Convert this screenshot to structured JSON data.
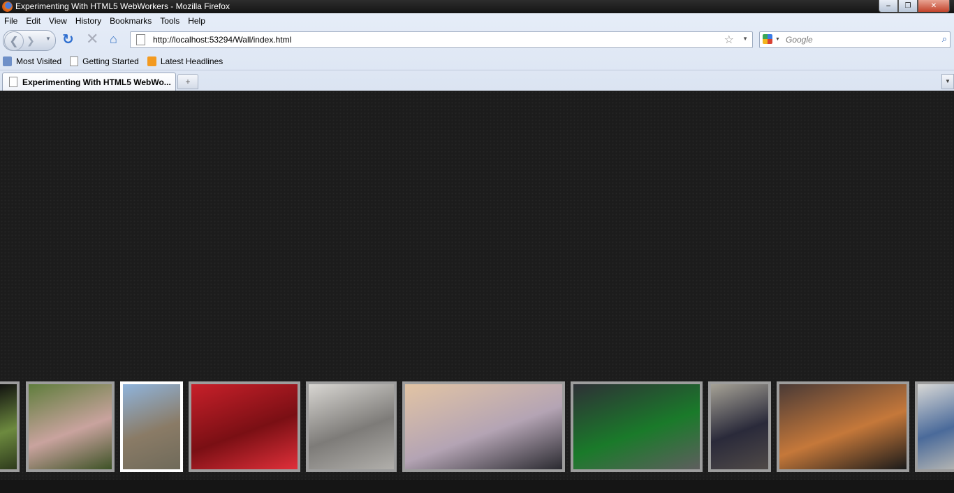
{
  "window": {
    "title": "Experimenting With HTML5 WebWorkers - Mozilla Firefox",
    "controls": {
      "minimize": "‒",
      "restore": "❐",
      "close": "✕"
    }
  },
  "menu": {
    "items": [
      "File",
      "Edit",
      "View",
      "History",
      "Bookmarks",
      "Tools",
      "Help"
    ]
  },
  "navigation": {
    "url": "http://localhost:53294/Wall/index.html",
    "search_placeholder": "Google",
    "icons": {
      "back": "❮",
      "forward": "❯",
      "reload": "↻",
      "stop": "✕",
      "home": "⌂",
      "bookmark_star": "☆",
      "search": "⌕",
      "dropdown": "▼"
    }
  },
  "bookmarks": {
    "items": [
      {
        "label": "Most Visited",
        "icon": "most-visited-icon"
      },
      {
        "label": "Getting Started",
        "icon": "page-icon"
      },
      {
        "label": "Latest Headlines",
        "icon": "rss-icon"
      }
    ]
  },
  "tabs": {
    "active_title": "Experimenting With HTML5 WebWo...",
    "new_tab": "+",
    "list": "▼"
  },
  "wall": {
    "thumbnails": [
      {
        "name": "grass",
        "selected": false,
        "colors": [
          "#0e0e0e",
          "#6d8a3f",
          "#2d3a1c"
        ]
      },
      {
        "name": "lily",
        "selected": false,
        "colors": [
          "#5f7d3c",
          "#c9a39e",
          "#3d5226"
        ]
      },
      {
        "name": "river-flower",
        "selected": true,
        "colors": [
          "#8fb4dc",
          "#8a7b66",
          "#6f6a5a"
        ]
      },
      {
        "name": "butterfly",
        "selected": false,
        "colors": [
          "#c8202a",
          "#7a0f14",
          "#e0303a"
        ]
      },
      {
        "name": "rose",
        "selected": false,
        "colors": [
          "#d8d6d2",
          "#7d7b78",
          "#b1afab"
        ]
      },
      {
        "name": "clouds",
        "selected": false,
        "colors": [
          "#e2c4a4",
          "#b4a4b4",
          "#2a2a30"
        ]
      },
      {
        "name": "lake-storm",
        "selected": false,
        "colors": [
          "#2e3036",
          "#1a7a2a",
          "#5e5e5e"
        ]
      },
      {
        "name": "family",
        "selected": false,
        "colors": [
          "#a6a296",
          "#2a2a3a",
          "#504a48"
        ]
      },
      {
        "name": "sunset",
        "selected": false,
        "colors": [
          "#4a3a36",
          "#c5783a",
          "#1a1a1a"
        ]
      },
      {
        "name": "partial",
        "selected": false,
        "colors": [
          "#d8d8d6",
          "#4a6a9a",
          "#b8b8b4"
        ]
      }
    ]
  }
}
